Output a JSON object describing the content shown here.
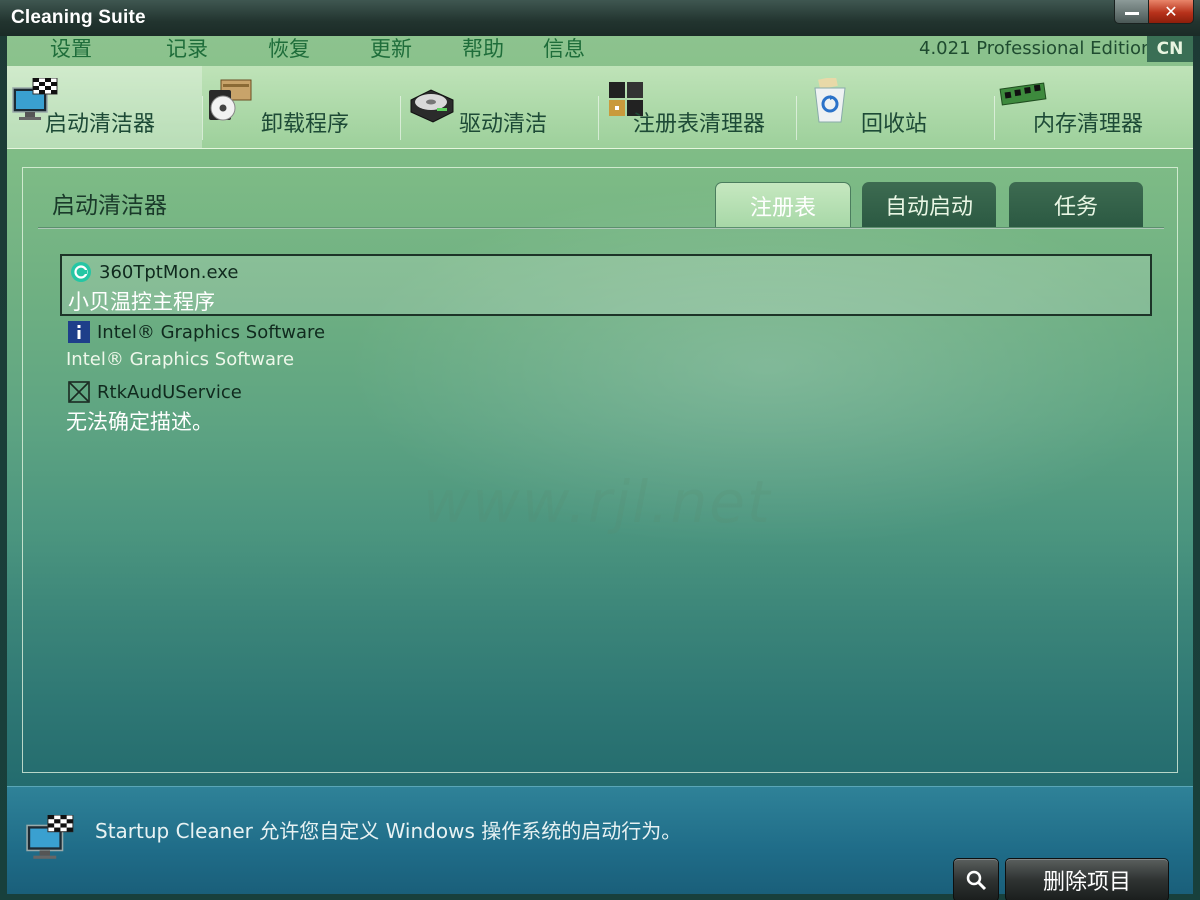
{
  "window": {
    "title": "Cleaning Suite"
  },
  "menu": {
    "items": [
      "设置",
      "记录",
      "恢复",
      "更新",
      "帮助",
      "信息"
    ],
    "edition": "4.021 Professional Edition",
    "lang": "CN"
  },
  "toolbar": {
    "tools": [
      {
        "label": "启动清洁器",
        "icon": "monitor-flag-icon",
        "active": true
      },
      {
        "label": "卸载程序",
        "icon": "uninstall-disc-icon",
        "active": false
      },
      {
        "label": "驱动清洁",
        "icon": "drive-icon",
        "active": false
      },
      {
        "label": "注册表清理器",
        "icon": "registry-blocks-icon",
        "active": false
      },
      {
        "label": "回收站",
        "icon": "recycle-bin-icon",
        "active": false
      },
      {
        "label": "内存清理器",
        "icon": "memory-module-icon",
        "active": false
      }
    ]
  },
  "panel": {
    "title": "启动清洁器",
    "tabs": [
      {
        "label": "注册表",
        "active": true
      },
      {
        "label": "自动启动",
        "active": false
      },
      {
        "label": "任务",
        "active": false
      }
    ],
    "entries": [
      {
        "name": "360TptMon.exe",
        "desc": "小贝温控主程序",
        "icon": "360-green-icon",
        "selected": true
      },
      {
        "name": "Intel® Graphics Software",
        "desc": "Intel® Graphics Software",
        "icon": "info-icon",
        "selected": false
      },
      {
        "name": "RtkAudUService",
        "desc": "无法确定描述。",
        "icon": "unknown-box-icon",
        "selected": false
      }
    ]
  },
  "watermark": "www.rjl.net",
  "footer": {
    "text": "Startup Cleaner 允许您自定义 Windows 操作系统的启动行为。",
    "delete_label": "删除项目"
  }
}
